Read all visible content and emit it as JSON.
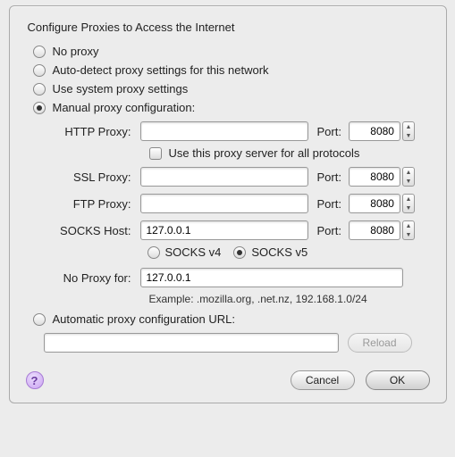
{
  "title": "Configure Proxies to Access the Internet",
  "radios": {
    "no_proxy": "No proxy",
    "auto_detect": "Auto-detect proxy settings for this network",
    "system": "Use system proxy settings",
    "manual": "Manual proxy configuration:",
    "auto_url": "Automatic proxy configuration URL:"
  },
  "labels": {
    "http": "HTTP Proxy:",
    "ssl": "SSL Proxy:",
    "ftp": "FTP Proxy:",
    "socks": "SOCKS Host:",
    "no_proxy_for": "No Proxy for:",
    "port": "Port:",
    "use_all": "Use this proxy server for all protocols",
    "socks4": "SOCKS v4",
    "socks5": "SOCKS v5",
    "example": "Example: .mozilla.org, .net.nz, 192.168.1.0/24"
  },
  "values": {
    "http_host": "",
    "http_port": "8080",
    "ssl_host": "",
    "ssl_port": "8080",
    "ftp_host": "",
    "ftp_port": "8080",
    "socks_host": "127.0.0.1",
    "socks_port": "8080",
    "no_proxy_for": "127.0.0.1",
    "auto_url": ""
  },
  "buttons": {
    "reload": "Reload",
    "cancel": "Cancel",
    "ok": "OK"
  },
  "help": "?"
}
